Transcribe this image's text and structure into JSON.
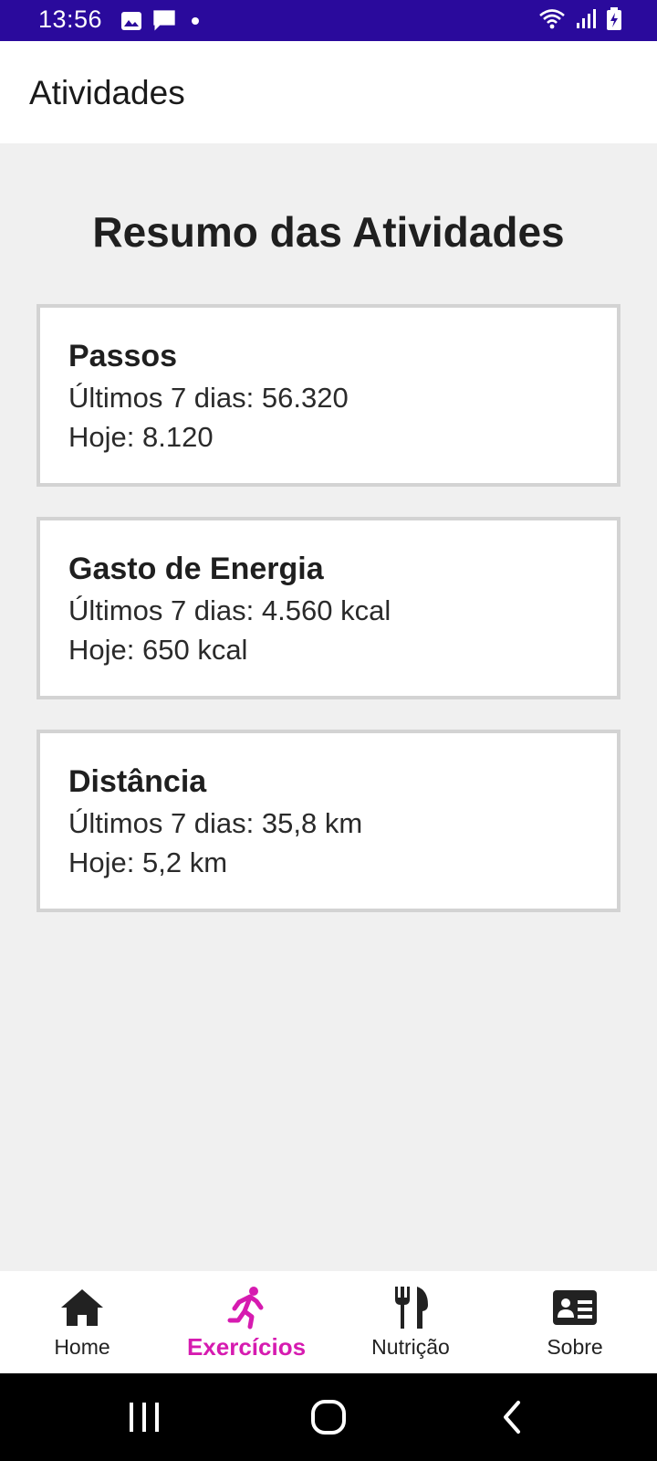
{
  "status_bar": {
    "time": "13:56",
    "left_icons": [
      "image-icon",
      "message-icon",
      "dot-icon"
    ],
    "right_icons": [
      "wifi-icon",
      "signal-icon",
      "battery-charging-icon"
    ],
    "background": "#2a0a9c"
  },
  "app_bar": {
    "title": "Atividades"
  },
  "main": {
    "heading": "Resumo das Atividades",
    "cards": [
      {
        "title": "Passos",
        "line1": "Últimos 7 dias: 56.320",
        "line2": "Hoje: 8.120"
      },
      {
        "title": "Gasto de Energia",
        "line1": "Últimos 7 dias: 4.560 kcal",
        "line2": "Hoje: 650 kcal"
      },
      {
        "title": "Distância",
        "line1": "Últimos 7 dias: 35,8 km",
        "line2": "Hoje: 5,2 km"
      }
    ]
  },
  "bottom_nav": {
    "active_color": "#d61bb0",
    "items": [
      {
        "label": "Home",
        "icon": "home-icon"
      },
      {
        "label": "Exercícios",
        "icon": "running-icon",
        "active": true
      },
      {
        "label": "Nutrição",
        "icon": "fork-knife-icon"
      },
      {
        "label": "Sobre",
        "icon": "contact-card-icon"
      }
    ]
  },
  "system_nav": {
    "buttons": [
      "recents-icon",
      "home-circle-icon",
      "back-icon"
    ]
  }
}
